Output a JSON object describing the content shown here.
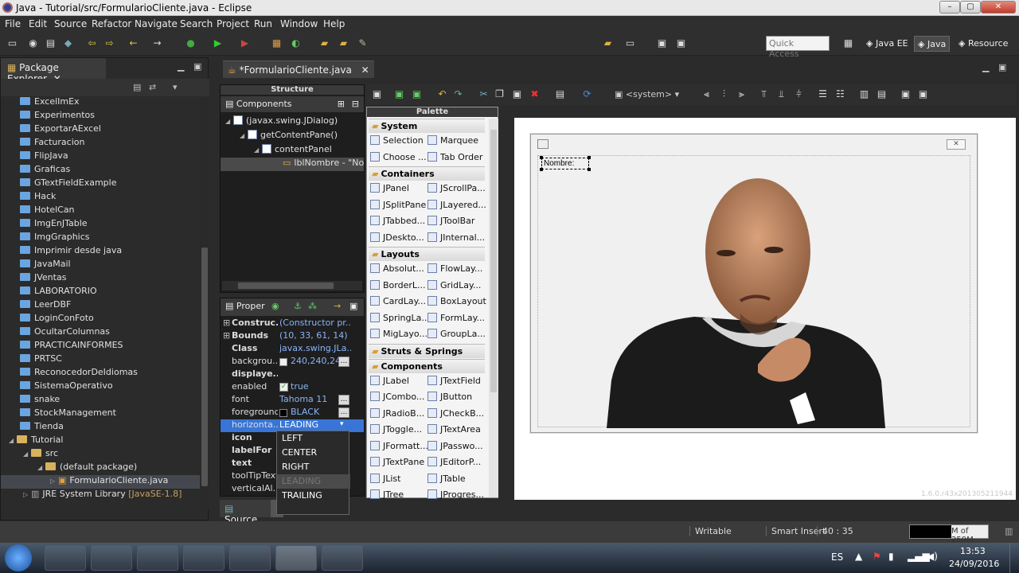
{
  "window": {
    "title": "Java - Tutorial/src/FormularioCliente.java - Eclipse"
  },
  "menu": [
    "File",
    "Edit",
    "Source",
    "Refactor",
    "Navigate",
    "Search",
    "Project",
    "Run",
    "Window",
    "Help"
  ],
  "toolbar": {
    "quick_access": "Quick Access",
    "perspectives": [
      "Java EE",
      "Java",
      "Resource"
    ]
  },
  "package_explorer": {
    "title": "Package Explorer",
    "items": [
      "ExcelImEx",
      "Experimentos",
      "ExportarAExcel",
      "Facturacion",
      "FlipJava",
      "Graficas",
      "GTextFieldExample",
      "Hack",
      "HotelCan",
      "ImgEnJTable",
      "ImgGraphics",
      "Imprimir desde java",
      "JavaMail",
      "JVentas",
      "LABORATORIO",
      "LeerDBF",
      "LoginConFoto",
      "OcultarColumnas",
      "PRACTICAINFORMES",
      "PRTSC",
      "ReconocedorDeIdiomas",
      "SistemaOperativo",
      "snake",
      "StockManagement",
      "Tienda"
    ],
    "expanded": {
      "project": "Tutorial",
      "src": "src",
      "package": "(default package)",
      "file": "FormularioCliente.java",
      "library": "JRE System Library",
      "library_suffix": "[JavaSE-1.8]"
    }
  },
  "editor": {
    "tab": "*FormularioCliente.java",
    "bottom_tab": "Source"
  },
  "structure": {
    "title": "Structure",
    "components_title": "Components",
    "nodes": [
      "(javax.swing.JDialog)",
      "getContentPane()",
      "contentPanel",
      "lblNombre - \"No"
    ]
  },
  "properties": {
    "title": "Proper",
    "rows": [
      {
        "key": "Construc...",
        "value": "(Constructor pr..."
      },
      {
        "key": "Bounds",
        "value": "(10, 33, 61, 14)"
      },
      {
        "key": "Class",
        "value": "javax.swing.JLa..."
      },
      {
        "key": "backgrou...",
        "value": "240,240,240"
      },
      {
        "key": "displaye...",
        "value": ""
      },
      {
        "key": "enabled",
        "value": "true"
      },
      {
        "key": "font",
        "value": "Tahoma 11"
      },
      {
        "key": "foreground",
        "value": "BLACK"
      },
      {
        "key": "horizonta...",
        "value": "LEADING"
      },
      {
        "key": "icon",
        "value": ""
      },
      {
        "key": "labelFor",
        "value": ""
      },
      {
        "key": "text",
        "value": ""
      },
      {
        "key": "toolTipText",
        "value": ""
      },
      {
        "key": "verticalAl...",
        "value": ""
      }
    ],
    "dropdown": [
      "LEFT",
      "CENTER",
      "RIGHT",
      "LEADING",
      "TRAILING"
    ]
  },
  "palette": {
    "title": "Palette",
    "system_label": "<system>",
    "categories": [
      {
        "name": "System",
        "items": [
          "Selection",
          "Marquee",
          "Choose ...",
          "Tab Order"
        ]
      },
      {
        "name": "Containers",
        "items": [
          "JPanel",
          "JScrollPa...",
          "JSplitPane",
          "JLayered...",
          "JTabbed...",
          "JToolBar",
          "JDeskto...",
          "JInternal..."
        ]
      },
      {
        "name": "Layouts",
        "items": [
          "Absolut...",
          "FlowLay...",
          "BorderL...",
          "GridLay...",
          "CardLay...",
          "BoxLayout",
          "SpringLa...",
          "FormLay...",
          "MigLayo...",
          "GroupLa..."
        ]
      },
      {
        "name": "Struts & Springs",
        "items": []
      },
      {
        "name": "Components",
        "items": [
          "JLabel",
          "JTextField",
          "JCombo...",
          "JButton",
          "JRadioB...",
          "JCheckB...",
          "JToggle...",
          "JTextArea",
          "JFormatt...",
          "JPasswo...",
          "JTextPane",
          "JEditorP...",
          "JList",
          "JTable",
          "JTree",
          "JProgres..."
        ]
      }
    ]
  },
  "design": {
    "label_text": "Nombre:",
    "version": "1.6.0.r43x201305211944"
  },
  "status": {
    "writable": "Writable",
    "insert": "Smart Insert",
    "position": "40 : 35",
    "memory": "M of 259M"
  },
  "taskbar": {
    "lang": "ES",
    "time": "13:53",
    "date": "24/09/2016"
  },
  "colors": {
    "selection": "#3875d7",
    "dark_bg": "#2b2b2b",
    "canvas": "#ffffff"
  }
}
